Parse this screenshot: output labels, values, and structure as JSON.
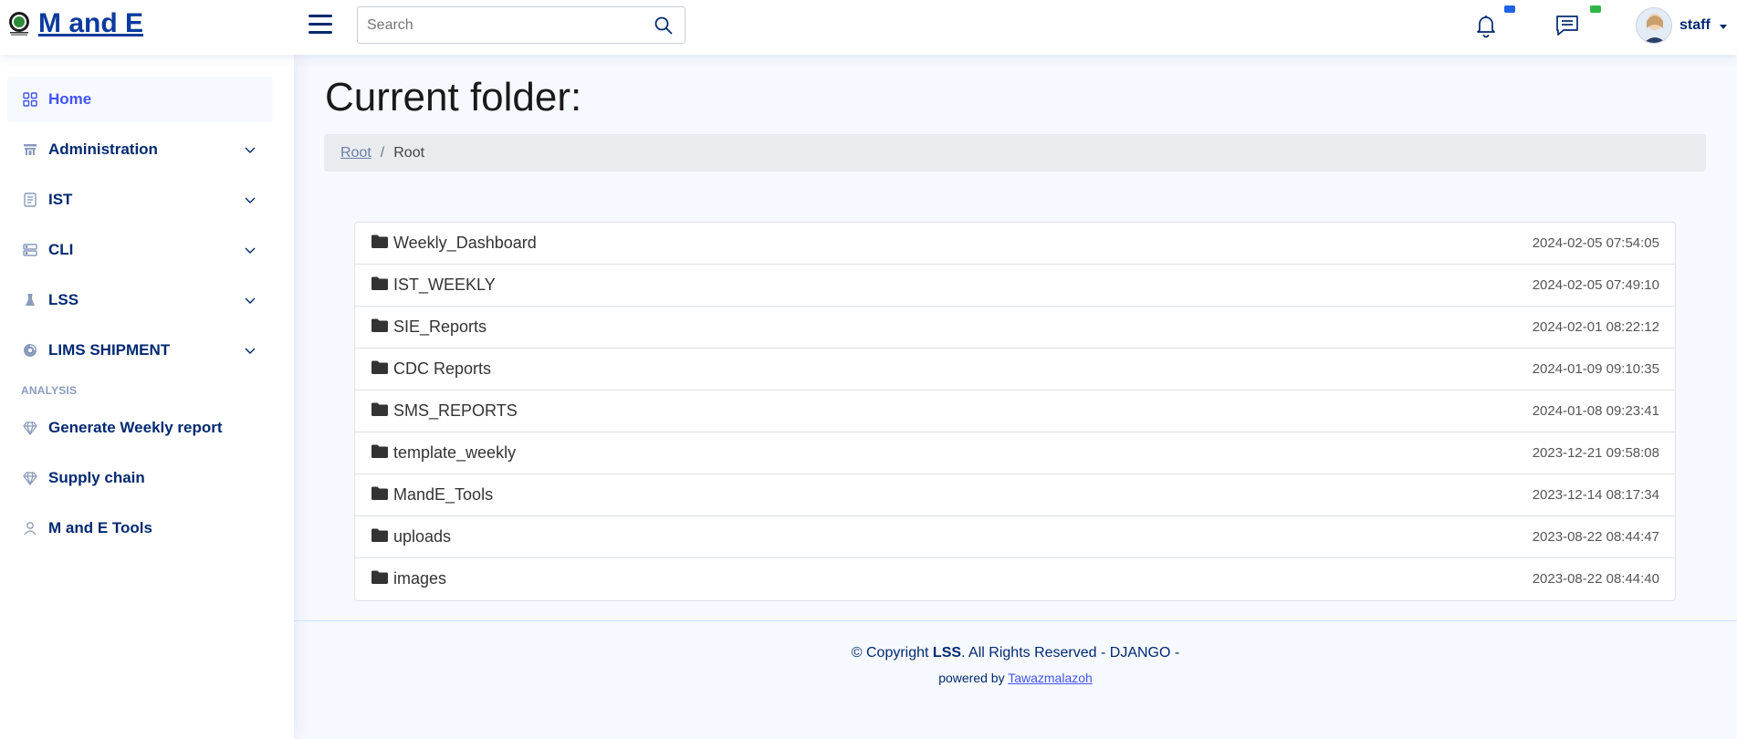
{
  "app": {
    "brand": "M and E",
    "accent": "#4154f1",
    "navy": "#012970"
  },
  "header": {
    "search_placeholder": "Search",
    "user_name": "staff"
  },
  "sidebar": {
    "items": [
      {
        "label": "Home",
        "icon": "grid-icon",
        "active": true
      },
      {
        "label": "Administration",
        "icon": "gate-icon"
      },
      {
        "label": "IST",
        "icon": "journal-icon"
      },
      {
        "label": "CLI",
        "icon": "server-icon"
      },
      {
        "label": "LSS",
        "icon": "flask-icon"
      },
      {
        "label": "LIMS SHIPMENT",
        "icon": "disc-icon"
      }
    ],
    "heading": "ANALYSIS",
    "analysis_items": [
      {
        "label": "Generate Weekly report",
        "icon": "gem-icon"
      },
      {
        "label": "Supply chain",
        "icon": "gem-icon"
      },
      {
        "label": "M and E Tools",
        "icon": "person-icon"
      }
    ]
  },
  "main": {
    "title": "Current folder:",
    "breadcrumb": {
      "link": "Root",
      "separator": "/",
      "current": "Root"
    },
    "folders": [
      {
        "name": "Weekly_Dashboard",
        "date": "2024-02-05 07:54:05"
      },
      {
        "name": "IST_WEEKLY",
        "date": "2024-02-05 07:49:10"
      },
      {
        "name": "SIE_Reports",
        "date": "2024-02-01 08:22:12"
      },
      {
        "name": "CDC Reports",
        "date": "2024-01-09 09:10:35"
      },
      {
        "name": "SMS_REPORTS",
        "date": "2024-01-08 09:23:41"
      },
      {
        "name": "template_weekly",
        "date": "2023-12-21 09:58:08"
      },
      {
        "name": "MandE_Tools",
        "date": "2023-12-14 08:17:34"
      },
      {
        "name": "uploads",
        "date": "2023-08-22 08:44:47"
      },
      {
        "name": "images",
        "date": "2023-08-22 08:44:40"
      }
    ]
  },
  "footer": {
    "copyright_pre": "© Copyright ",
    "copyright_brand": "LSS",
    "copyright_post": ". All Rights Reserved - DJANGO -",
    "powered_pre": "powered by ",
    "powered_link": "Tawazmalazoh"
  }
}
